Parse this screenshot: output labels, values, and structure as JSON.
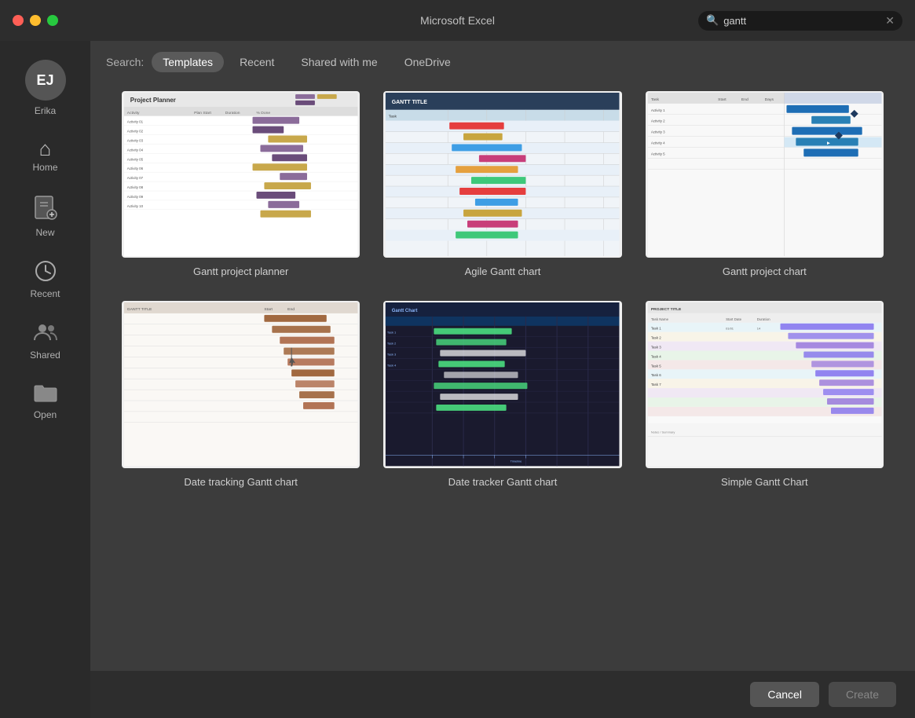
{
  "titlebar": {
    "title": "Microsoft Excel",
    "search_placeholder": "gantt",
    "search_value": "gantt",
    "buttons": {
      "close": "●",
      "minimize": "●",
      "maximize": "●"
    }
  },
  "sidebar": {
    "user": {
      "initials": "EJ",
      "name": "Erika"
    },
    "items": [
      {
        "id": "home",
        "label": "Home",
        "icon": "🏠"
      },
      {
        "id": "new",
        "label": "New",
        "icon": "📄"
      },
      {
        "id": "recent",
        "label": "Recent",
        "icon": "🕐"
      },
      {
        "id": "shared",
        "label": "Shared",
        "icon": "👥"
      },
      {
        "id": "open",
        "label": "Open",
        "icon": "📁"
      }
    ]
  },
  "tabs": {
    "search_label": "Search:",
    "items": [
      {
        "id": "templates",
        "label": "Templates",
        "active": true
      },
      {
        "id": "recent",
        "label": "Recent",
        "active": false
      },
      {
        "id": "shared-with-me",
        "label": "Shared with me",
        "active": false
      },
      {
        "id": "onedrive",
        "label": "OneDrive",
        "active": false
      }
    ]
  },
  "templates": [
    {
      "id": "gantt-project-planner",
      "name": "Gantt project planner",
      "type": "planner"
    },
    {
      "id": "agile-gantt-chart",
      "name": "Agile Gantt chart",
      "type": "agile"
    },
    {
      "id": "gantt-project-chart",
      "name": "Gantt project chart",
      "type": "project-chart"
    },
    {
      "id": "date-tracking-gantt",
      "name": "Date tracking Gantt chart",
      "type": "date-tracking"
    },
    {
      "id": "date-tracker-gantt",
      "name": "Date tracker Gantt chart",
      "type": "date-tracker"
    },
    {
      "id": "simple-gantt",
      "name": "Simple Gantt Chart",
      "type": "simple"
    }
  ],
  "footer": {
    "cancel_label": "Cancel",
    "create_label": "Create"
  }
}
